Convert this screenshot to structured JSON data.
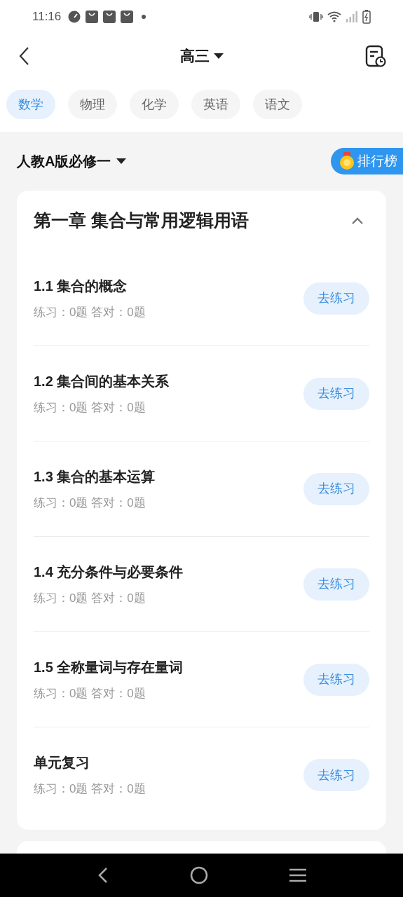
{
  "status_bar": {
    "time": "11:16"
  },
  "header": {
    "title": "高三"
  },
  "tabs": [
    {
      "label": "数学",
      "selected": true
    },
    {
      "label": "物理",
      "selected": false
    },
    {
      "label": "化学",
      "selected": false
    },
    {
      "label": "英语",
      "selected": false
    },
    {
      "label": "语文",
      "selected": false
    }
  ],
  "book": {
    "title": "人教A版必修一",
    "ranking_button": "排行榜"
  },
  "chapter": {
    "title": "第一章 集合与常用逻辑用语",
    "expanded": true,
    "sections": [
      {
        "title": "1.1 集合的概念",
        "stats": "练习：0题 答对：0题",
        "button": "去练习"
      },
      {
        "title": "1.2 集合间的基本关系",
        "stats": "练习：0题 答对：0题",
        "button": "去练习"
      },
      {
        "title": "1.3 集合的基本运算",
        "stats": "练习：0题 答对：0题",
        "button": "去练习"
      },
      {
        "title": "1.4 充分条件与必要条件",
        "stats": "练习：0题 答对：0题",
        "button": "去练习"
      },
      {
        "title": "1.5 全称量词与存在量词",
        "stats": "练习：0题 答对：0题",
        "button": "去练习"
      },
      {
        "title": "单元复习",
        "stats": "练习：0题 答对：0题",
        "button": "去练习"
      }
    ]
  }
}
